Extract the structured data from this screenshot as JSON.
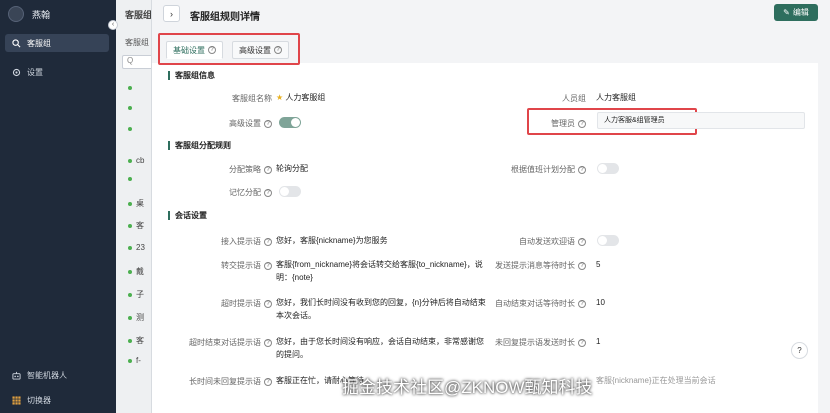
{
  "sidebar": {
    "brand": "燕翰",
    "items": [
      {
        "label": "客服组",
        "icon": "search-icon",
        "active": true
      },
      {
        "label": "设置",
        "icon": "gear-icon",
        "active": false
      }
    ],
    "bottom": [
      {
        "label": "智能机器人",
        "icon": "robot-icon"
      },
      {
        "label": "切换器",
        "icon": "grid-icon"
      }
    ]
  },
  "list_panel": {
    "header": "客服组",
    "sub": "客服组",
    "search_placeholder": "Q",
    "rows": [
      "",
      "",
      "",
      "",
      "cb",
      "",
      "桌",
      "客",
      "23",
      "戴",
      "子",
      "测",
      "客",
      "f-"
    ]
  },
  "main": {
    "title": "客服组规则详情",
    "edit_label": "编辑",
    "tabs": [
      {
        "label": "基础设置",
        "active": true
      },
      {
        "label": "高级设置",
        "active": false
      }
    ],
    "sections": {
      "info": "客服组信息",
      "assign": "客服组分配规则",
      "session": "会话设置"
    },
    "fields": {
      "group_name_label": "客服组名称",
      "group_name_value": "人力客服组",
      "member_label": "人员组",
      "member_value": "人力客服组",
      "advanced_label": "高级设置",
      "admin_label": "管理员",
      "admin_value": "人力客服&组管理员",
      "strategy_label": "分配策略",
      "strategy_value": "轮询分配",
      "schedule_label": "根据值班计划分配",
      "memory_label": "记忆分配",
      "welcome_label": "接入提示语",
      "welcome_value": "您好，客服{nickname}为您服务",
      "auto_welcome_label": "自动发送欢迎语",
      "transfer_label": "转交提示语",
      "transfer_value": "客服{from_nickname}将会话转交给客服{to_nickname}，说明：{note}",
      "send_wait_label": "发送提示消息等待时长",
      "send_wait_value": "5",
      "timeout_label": "超时提示语",
      "timeout_value": "您好，我们长时间没有收到您的回复，{n}分钟后将自动结束本次会话。",
      "auto_end_label": "自动结束对话等待时长",
      "auto_end_value": "10",
      "timeout_end_label": "超时结束对话提示语",
      "timeout_end_value": "您好，由于您长时间没有响应，会话自动结束，非常感谢您的提问。",
      "unreplied_label": "未回复提示语发送时长",
      "unreplied_value": "1",
      "no_reply_label": "长时间未回复提示语",
      "no_reply_value": "客服正在忙，请耐心等待",
      "partial_right": "客服{nickname}正在处理当前会话"
    },
    "help": "?"
  },
  "watermark": "掘金技术社区@ZKNOW甄知科技"
}
